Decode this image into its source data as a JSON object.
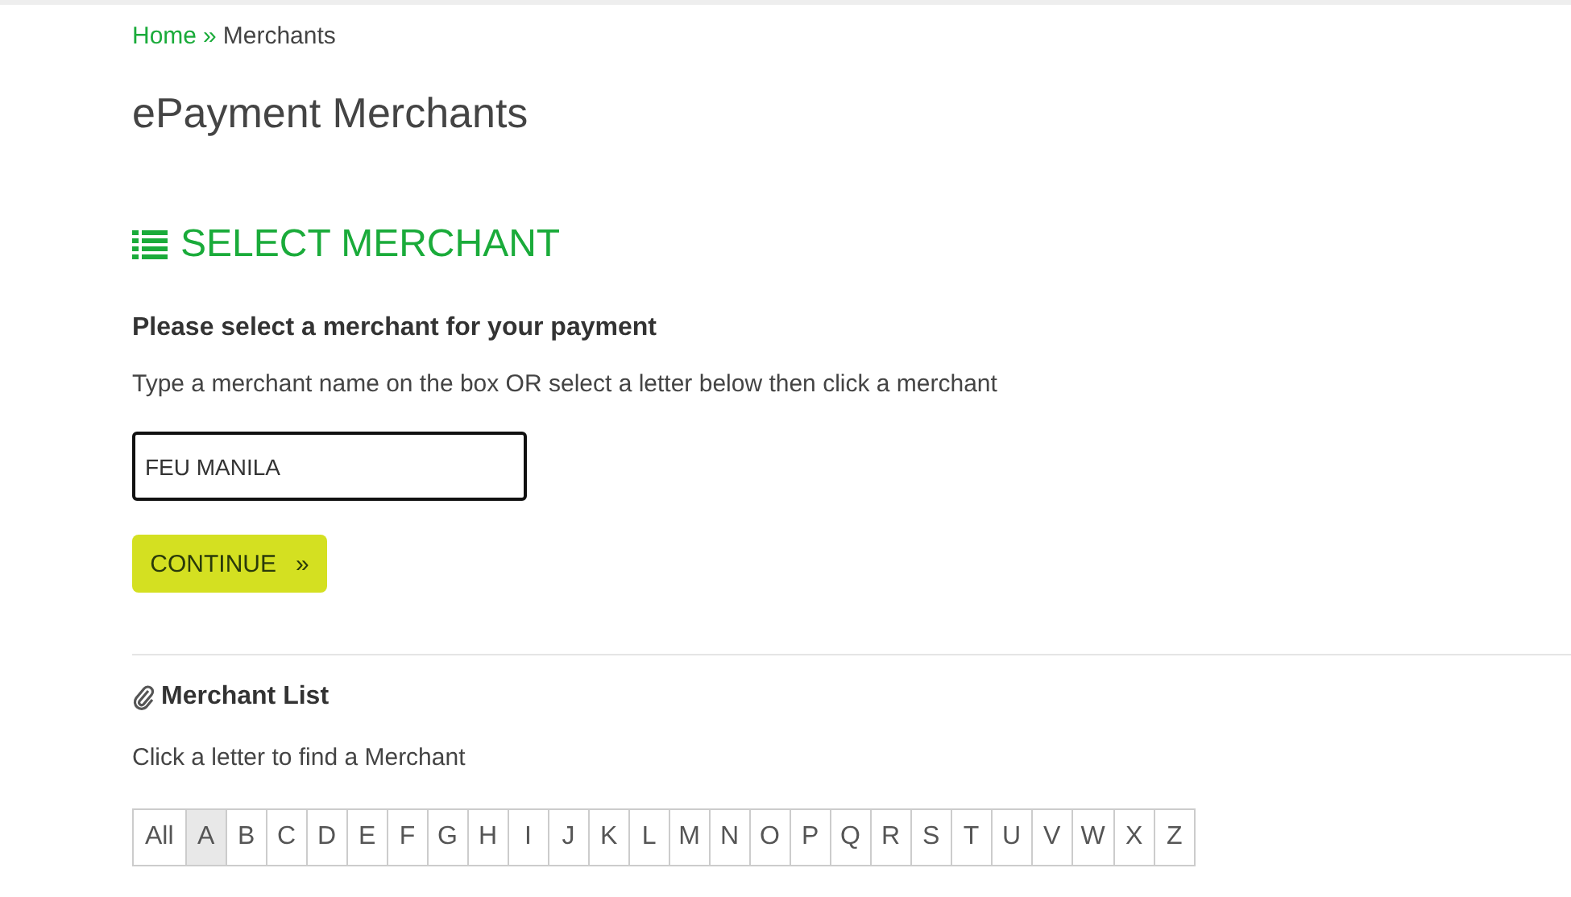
{
  "breadcrumb": [
    {
      "label": "Home",
      "link": true
    },
    {
      "label": "Merchants",
      "link": false
    }
  ],
  "breadcrumb_separator": "»",
  "title": "ePayment Merchants",
  "section_heading": "SELECT MERCHANT",
  "prompt": "Please select a merchant for your payment",
  "instructions": "Type a merchant name on the box OR select a letter below then click a merchant",
  "merchant_field": {
    "value": "FEU MANILA"
  },
  "continue_button": {
    "label": "CONTINUE",
    "icon": "»"
  },
  "merchant_list": {
    "heading": "Merchant List",
    "hint": "Click a letter to find a Merchant",
    "letters": [
      {
        "label": "All",
        "selected": false
      },
      {
        "label": "A",
        "selected": true
      },
      {
        "label": "B",
        "selected": false
      },
      {
        "label": "C",
        "selected": false
      },
      {
        "label": "D",
        "selected": false
      },
      {
        "label": "E",
        "selected": false
      },
      {
        "label": "F",
        "selected": false
      },
      {
        "label": "G",
        "selected": false
      },
      {
        "label": "H",
        "selected": false
      },
      {
        "label": "I",
        "selected": false
      },
      {
        "label": "J",
        "selected": false
      },
      {
        "label": "K",
        "selected": false
      },
      {
        "label": "L",
        "selected": false
      },
      {
        "label": "M",
        "selected": false
      },
      {
        "label": "N",
        "selected": false
      },
      {
        "label": "O",
        "selected": false
      },
      {
        "label": "P",
        "selected": false
      },
      {
        "label": "Q",
        "selected": false
      },
      {
        "label": "R",
        "selected": false
      },
      {
        "label": "S",
        "selected": false
      },
      {
        "label": "T",
        "selected": false
      },
      {
        "label": "U",
        "selected": false
      },
      {
        "label": "V",
        "selected": false
      },
      {
        "label": "W",
        "selected": false
      },
      {
        "label": "X",
        "selected": false
      },
      {
        "label": "Z",
        "selected": false
      }
    ]
  }
}
